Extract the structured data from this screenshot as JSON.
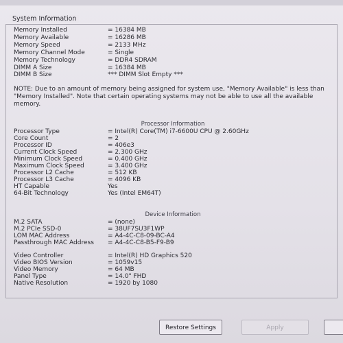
{
  "window": {
    "group_title": "System Information"
  },
  "memory": [
    {
      "label": "Memory Installed",
      "value": "= 16384 MB"
    },
    {
      "label": "Memory Available",
      "value": "= 16286 MB"
    },
    {
      "label": "Memory Speed",
      "value": "= 2133 MHz"
    },
    {
      "label": "Memory Channel Mode",
      "value": "= Single"
    },
    {
      "label": "Memory Technology",
      "value": "= DDR4 SDRAM"
    },
    {
      "label": "DIMM A Size",
      "value": "= 16384 MB"
    },
    {
      "label": "DIMM B Size",
      "value": "*** DIMM Slot Empty ***"
    }
  ],
  "note": "NOTE: Due to an amount of memory being assigned for system use, \"Memory Available\" is less than \"Memory Installed\". Note that certain operating systems may not be able to use all the available memory.",
  "processor_heading": "Processor Information",
  "processor": [
    {
      "label": "Processor Type",
      "value": "= Intel(R) Core(TM) i7-6600U CPU @ 2.60GHz"
    },
    {
      "label": "Core Count",
      "value": "= 2"
    },
    {
      "label": "Processor ID",
      "value": "= 406e3"
    },
    {
      "label": "Current Clock Speed",
      "value": "= 2.300 GHz"
    },
    {
      "label": "Minimum Clock Speed",
      "value": "= 0.400 GHz"
    },
    {
      "label": "Maximum Clock Speed",
      "value": "= 3.400 GHz"
    },
    {
      "label": "Processor L2 Cache",
      "value": "= 512 KB"
    },
    {
      "label": "Processor L3 Cache",
      "value": "= 4096 KB"
    },
    {
      "label": "HT Capable",
      "value": "Yes"
    },
    {
      "label": "64-Bit Technology",
      "value": "Yes (Intel EM64T)"
    }
  ],
  "device_heading": "Device Information",
  "device": [
    {
      "label": "M.2 SATA",
      "value": "= (none)"
    },
    {
      "label": "M.2 PCIe SSD-0",
      "value": "= 38UF7SU3F1WP"
    },
    {
      "label": "LOM MAC Address",
      "value": "= A4-4C-C8-09-BC-A4"
    },
    {
      "label": "Passthrough MAC Address",
      "value": "= A4-4C-C8-B5-F9-B9"
    }
  ],
  "video": [
    {
      "label": "Video Controller",
      "value": "= Intel(R) HD Graphics 520"
    },
    {
      "label": "Video BIOS Version",
      "value": "= 1059v15"
    },
    {
      "label": "Video Memory",
      "value": "= 64 MB"
    },
    {
      "label": "Panel Type",
      "value": "= 14.0\" FHD"
    },
    {
      "label": "Native Resolution",
      "value": "= 1920 by 1080"
    }
  ],
  "buttons": {
    "restore": "Restore Settings",
    "apply": "Apply"
  }
}
